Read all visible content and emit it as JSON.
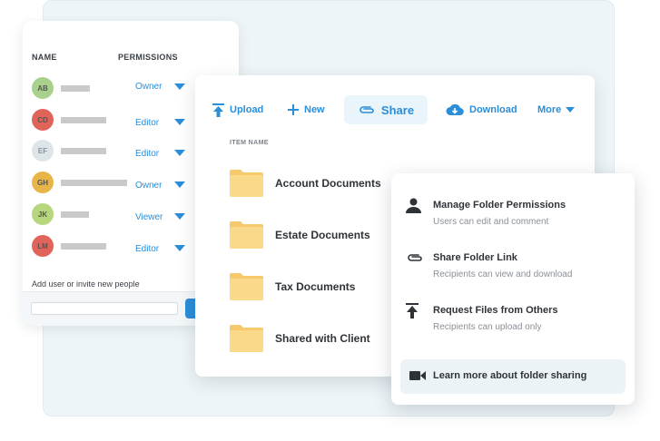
{
  "permissions": {
    "name_header": "NAME",
    "permissions_header": "PERMISSIONS",
    "users": [
      {
        "initials": "AB",
        "role": "Owner",
        "avatar_color": "#a9d18e"
      },
      {
        "initials": "CD",
        "role": "Editor",
        "avatar_color": "#e0645a"
      },
      {
        "initials": "EF",
        "role": "Editor",
        "avatar_color": "#dde5e8"
      },
      {
        "initials": "GH",
        "role": "Owner",
        "avatar_color": "#e8b548"
      },
      {
        "initials": "JK",
        "role": "Viewer",
        "avatar_color": "#b7d77e"
      },
      {
        "initials": "LM",
        "role": "Editor",
        "avatar_color": "#e0645a"
      }
    ],
    "invite_label": "Add user or invite new people",
    "invite_placeholder": ""
  },
  "toolbar": {
    "upload": "Upload",
    "new": "New",
    "share": "Share",
    "download": "Download",
    "more": "More"
  },
  "files": {
    "header": "ITEM NAME",
    "items": [
      {
        "name": "Account Documents",
        "icon": "folder-icon"
      },
      {
        "name": "Estate Documents",
        "icon": "folder-icon"
      },
      {
        "name": "Tax Documents",
        "icon": "folder-icon"
      },
      {
        "name": "Shared with Client",
        "icon": "folder-icon"
      }
    ]
  },
  "share_menu": {
    "items": [
      {
        "title": "Manage Folder Permissions",
        "subtitle": "Users can edit and comment",
        "icon": "person-icon"
      },
      {
        "title": "Share Folder Link",
        "subtitle": "Recipients can view and download",
        "icon": "paperclip-icon"
      },
      {
        "title": "Request Files from Others",
        "subtitle": "Recipients can upload only",
        "icon": "upload-icon"
      }
    ],
    "learn_more": "Learn more about folder sharing",
    "learn_more_icon": "video-camera-icon"
  },
  "colors": {
    "accent": "#2a8ed8",
    "folder": "#fbd98a",
    "background_panel": "#eef5f8"
  }
}
